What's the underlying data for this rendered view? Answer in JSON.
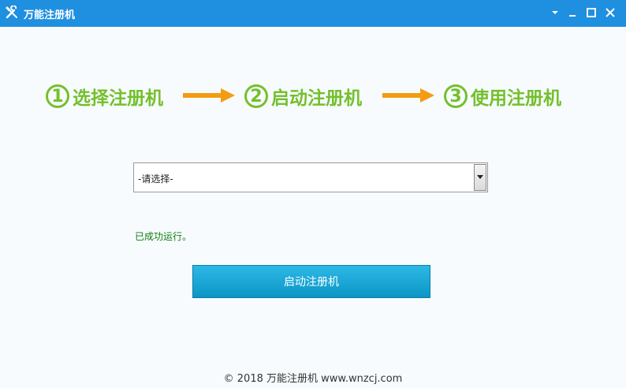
{
  "window": {
    "title": "万能注册机",
    "icon": "wrench-screwdriver-icon",
    "controls": [
      "dropdown-icon",
      "minimize-icon",
      "maximize-icon",
      "close-icon"
    ]
  },
  "steps": [
    {
      "number": "1",
      "label": "选择注册机"
    },
    {
      "number": "2",
      "label": "启动注册机"
    },
    {
      "number": "3",
      "label": "使用注册机"
    }
  ],
  "colors": {
    "titlebar": "#1f8fe0",
    "step_green": "#74c02c",
    "arrow_orange": "#f39c12",
    "status_green": "#117d11",
    "button_blue": "#0b96c6"
  },
  "selector": {
    "value": "-请选择-"
  },
  "status": {
    "text": "已成功运行。"
  },
  "start_button": {
    "label": "启动注册机"
  },
  "footer": {
    "text": "© 2018 万能注册机 www.wnzcj.com"
  }
}
